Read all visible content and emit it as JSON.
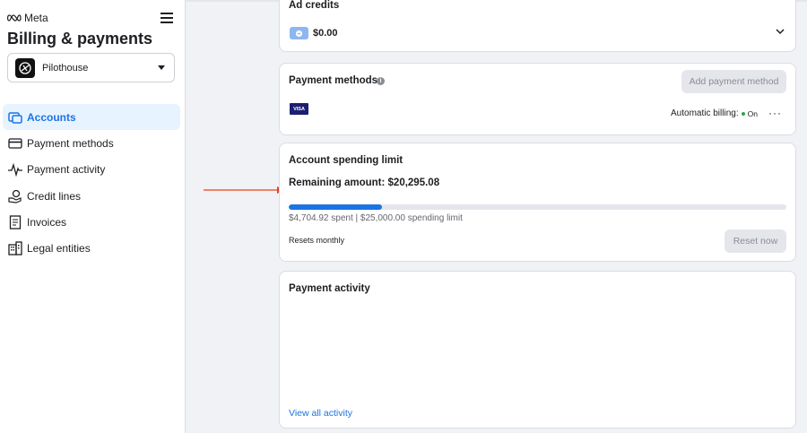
{
  "app": {
    "brand": "Meta",
    "title": "Billing & payments"
  },
  "account": {
    "name": "Pilothouse"
  },
  "sidebar": {
    "items": [
      {
        "label": "Accounts",
        "icon": "accounts-icon",
        "active": true
      },
      {
        "label": "Payment methods",
        "icon": "card-icon",
        "active": false
      },
      {
        "label": "Payment activity",
        "icon": "activity-icon",
        "active": false
      },
      {
        "label": "Credit lines",
        "icon": "credit-lines-icon",
        "active": false
      },
      {
        "label": "Invoices",
        "icon": "invoice-icon",
        "active": false
      },
      {
        "label": "Legal entities",
        "icon": "building-icon",
        "active": false
      }
    ]
  },
  "ad_credits": {
    "title": "Ad credits",
    "amount": "$0.00"
  },
  "payment_methods": {
    "title": "Payment methods",
    "info": "i",
    "add_button": "Add payment method",
    "card_brand": "VISA",
    "auto_billing_label": "Automatic billing:",
    "auto_billing_status": "On",
    "more": "···"
  },
  "spending_limit": {
    "title": "Account spending limit",
    "remaining": "Remaining amount: $20,295.08",
    "spent_fraction": 0.188,
    "spent_text": "$4,704.92 spent | $25,000.00 spending limit",
    "resets": "Resets monthly",
    "reset_button": "Reset now"
  },
  "payment_activity": {
    "title": "Payment activity",
    "view_all": "View all activity"
  },
  "colors": {
    "accent": "#1b74e4",
    "annotation_arrow": "#e8401c",
    "status_on": "#31a24c"
  }
}
